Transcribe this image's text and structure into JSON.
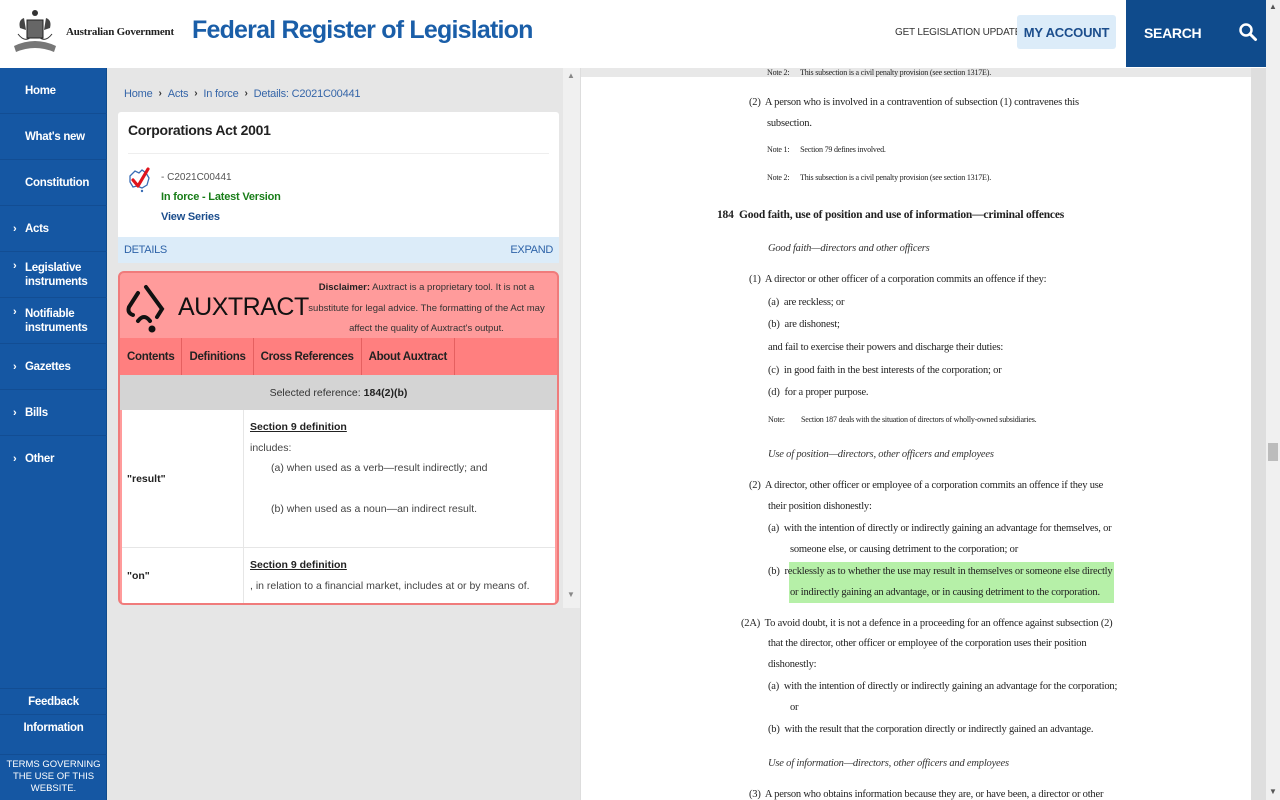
{
  "header": {
    "gov_label": "Australian Government",
    "site_title": "Federal Register of Legislation",
    "updates_link": "GET LEGISLATION UPDATES",
    "account_button": "MY ACCOUNT",
    "search_button": "SEARCH",
    "icons": {
      "crest": "coat-of-arms-icon",
      "search": "search-icon"
    }
  },
  "sidenav": {
    "items": [
      {
        "label": "Home",
        "chevron": false
      },
      {
        "label": "What's new",
        "chevron": false
      },
      {
        "label": "Constitution",
        "chevron": false
      },
      {
        "label": "Acts",
        "chevron": true
      },
      {
        "label": "Legislative instruments",
        "chevron": true
      },
      {
        "label": "Notifiable instruments",
        "chevron": true
      },
      {
        "label": "Gazettes",
        "chevron": true
      },
      {
        "label": "Bills",
        "chevron": true
      },
      {
        "label": "Other",
        "chevron": true
      }
    ],
    "chevron_glyph": "›",
    "footer": {
      "feedback": "Feedback",
      "information": "Information",
      "terms": "TERMS GOVERNING THE USE OF THIS WEBSITE."
    }
  },
  "breadcrumb": [
    "Home",
    "Acts",
    "In force",
    "Details: C2021C00441"
  ],
  "breadcrumb_sep": "›",
  "act": {
    "title": "Corporations Act 2001",
    "id": "- C2021C00441",
    "status": "In force - Latest Version",
    "view_series": "View Series",
    "details_label": "DETAILS",
    "expand_label": "EXPAND"
  },
  "auxtract": {
    "name": "AUXTRACT",
    "disclaimer_bold": "Disclaimer:",
    "disclaimer_text": "Auxtract is a proprietary tool. It is not a substitute for legal advice. The formatting of the Act may affect the quality of Auxtract's output.",
    "tabs": [
      "Contents",
      "Definitions",
      "Cross References",
      "About Auxtract"
    ],
    "selected_label": "Selected reference:",
    "selected_value": "184(2)(b)",
    "definitions": [
      {
        "term": "\"result\"",
        "heading": "Section 9 definition",
        "lines": [
          "includes:",
          "(a) when used as a verb—result indirectly; and",
          "(b) when used as a noun—an indirect result."
        ]
      },
      {
        "term": "\"on\"",
        "heading": "Section 9 definition",
        "lines": [
          ", in relation to a financial market, includes at or by means of."
        ]
      }
    ]
  },
  "document": {
    "lines": [
      {
        "text": "Note 2:      This subsection is a civil penalty provision (see section 1317E).",
        "style": "small"
      },
      {
        "text": "(2)  A person who is involved in a contravention of subsection (1) contravenes this",
        "style": "body"
      },
      {
        "text": "subsection.",
        "style": "body"
      },
      {
        "text": "Note 1:      Section 79 defines involved.",
        "style": "small"
      },
      {
        "text": "Note 2:      This subsection is a civil penalty provision (see section 1317E).",
        "style": "small"
      },
      {
        "text": "184  Good faith, use of position and use of information—criminal offences",
        "style": "head"
      },
      {
        "text": "Good faith—directors and other officers",
        "style": "ital"
      },
      {
        "text": "(1)  A director or other officer of a corporation commits an offence if they:",
        "style": "body"
      },
      {
        "text": "(a)  are reckless; or",
        "style": "body"
      },
      {
        "text": "(b)  are dishonest;",
        "style": "body"
      },
      {
        "text": "and fail to exercise their powers and discharge their duties:",
        "style": "body"
      },
      {
        "text": "(c)  in good faith in the best interests of the corporation; or",
        "style": "body"
      },
      {
        "text": "(d)  for a proper purpose.",
        "style": "body"
      },
      {
        "text": "Note:         Section 187 deals with the situation of directors of wholly-owned subsidiaries.",
        "style": "small"
      },
      {
        "text": "Use of position—directors, other officers and employees",
        "style": "ital"
      },
      {
        "text": "(2)  A director, other officer or employee of a corporation commits an offence if they use",
        "style": "body"
      },
      {
        "text": "their position dishonestly:",
        "style": "body"
      },
      {
        "text": "(a)  with the intention of directly or indirectly gaining an advantage for themselves, or",
        "style": "body"
      },
      {
        "text": "someone else, or causing detriment to the corporation; or",
        "style": "body"
      },
      {
        "text": "(b)  recklessly as to whether the use may result in themselves or someone else directly",
        "style": "body"
      },
      {
        "text": "or indirectly gaining an advantage, or in causing detriment to the corporation.",
        "style": "body"
      },
      {
        "text": "(2A)  To avoid doubt, it is not a defence in a proceeding for an offence against subsection (2)",
        "style": "body"
      },
      {
        "text": "that the director, other officer or employee of the corporation uses their position",
        "style": "body"
      },
      {
        "text": "dishonestly:",
        "style": "body"
      },
      {
        "text": "(a)  with the intention of directly or indirectly gaining an advantage for the corporation;",
        "style": "body"
      },
      {
        "text": "or",
        "style": "body"
      },
      {
        "text": "(b)  with the result that the corporation directly or indirectly gained an advantage.",
        "style": "body"
      },
      {
        "text": "Use of information—directors, other officers and employees",
        "style": "ital"
      },
      {
        "text": "(3)  A person who obtains information because they are, or have been, a director or other",
        "style": "body"
      }
    ],
    "highlight_color": "#b6f0a8",
    "highlighted_ref": "184(2)(b)"
  },
  "colors": {
    "brand_blue": "#1557a3",
    "title_blue": "#1a5ea8",
    "search_blue": "#0f4b8c",
    "status_green": "#187d18",
    "auxtract_pink": "#ff9b9b",
    "auxtract_tabs": "#ff7f7f"
  }
}
